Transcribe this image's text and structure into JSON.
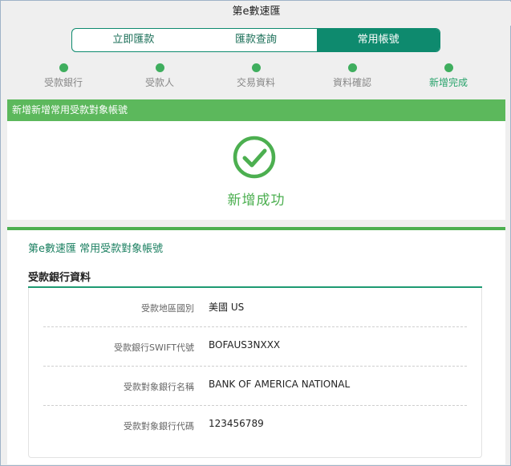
{
  "header": {
    "title": "第e數速匯"
  },
  "tabs": [
    {
      "label": "立即匯款"
    },
    {
      "label": "匯款查詢"
    },
    {
      "label": "常用帳號",
      "active": true
    }
  ],
  "steps": [
    {
      "label": "受款銀行"
    },
    {
      "label": "受款人"
    },
    {
      "label": "交易資料"
    },
    {
      "label": "資料確認"
    },
    {
      "label": "新增完成",
      "current": true
    }
  ],
  "banner": {
    "text": "新增新增常用受款對象帳號"
  },
  "success": {
    "icon": "check-circle-icon",
    "text": "新增成功"
  },
  "detail": {
    "title": "第e數速匯 常用受款對象帳號",
    "section_title": "受款銀行資料",
    "rows": [
      {
        "label": "受款地區國別",
        "value": "美國 US"
      },
      {
        "label": "受款銀行SWIFT代號",
        "value": "BOFAUS3NXXX"
      },
      {
        "label": "受款對象銀行名稱",
        "value": "BANK OF AMERICA NATIONAL"
      },
      {
        "label": "受款對象銀行代碼",
        "value": "123456789"
      }
    ]
  },
  "colors": {
    "accent": "#0e8a6e",
    "success": "#4caf50",
    "banner": "#5cb85c"
  }
}
